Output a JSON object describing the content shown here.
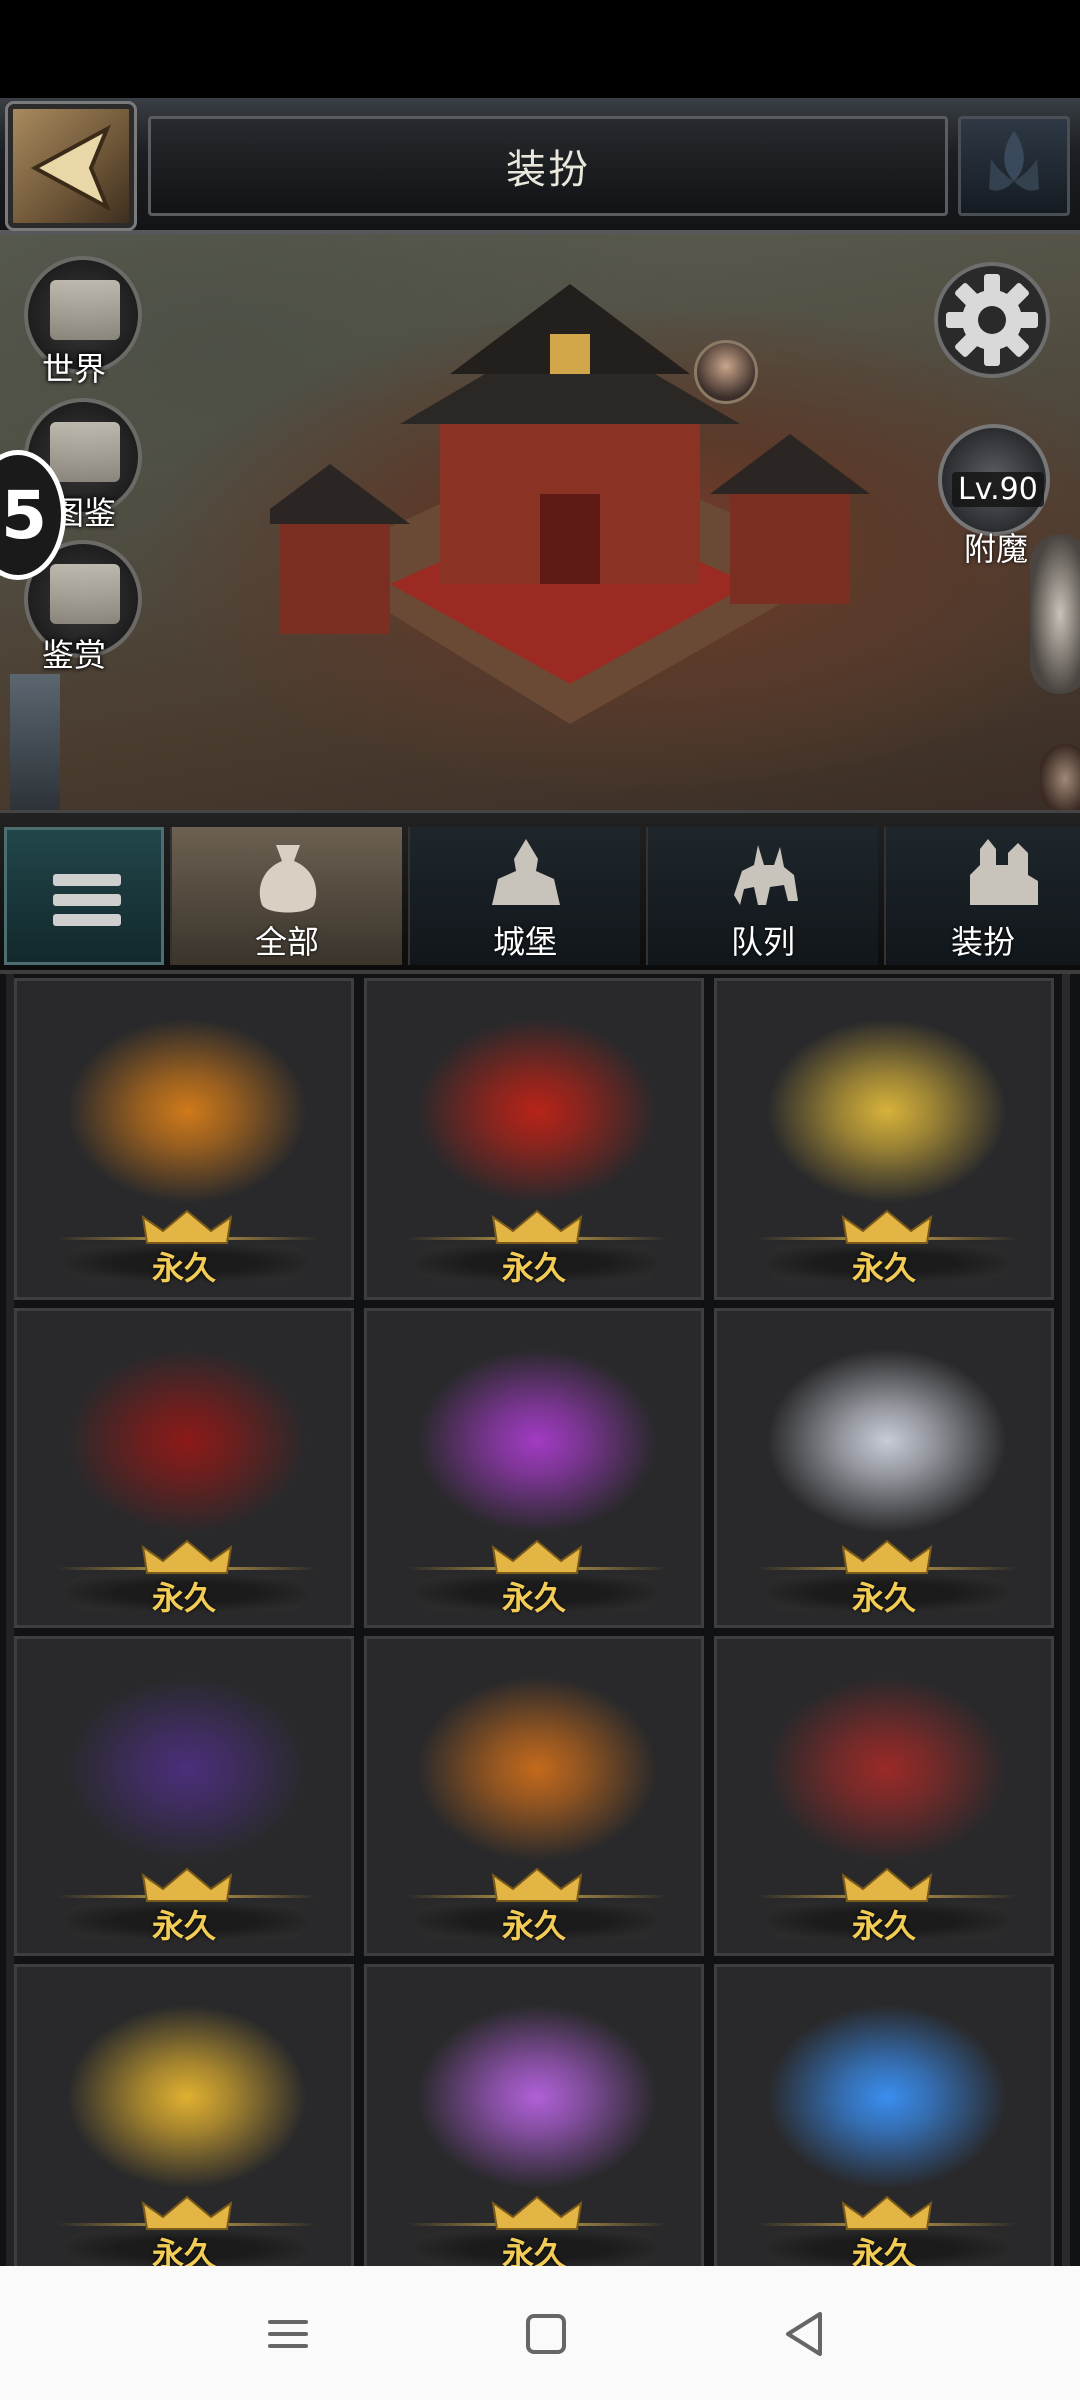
{
  "header": {
    "title": "装扮"
  },
  "scene": {
    "side_buttons": [
      {
        "label": "世界",
        "icon": "world-map-icon"
      },
      {
        "label": "图鉴",
        "icon": "codex-book-icon"
      },
      {
        "label": "鉴赏",
        "icon": "appreciate-icon"
      }
    ],
    "level": "Lv.90",
    "enchant_label": "附魔",
    "badge_number": "5"
  },
  "tabs": [
    {
      "label": "全部",
      "icon": "bag-icon",
      "active": true
    },
    {
      "label": "城堡",
      "icon": "castle-icon",
      "active": false
    },
    {
      "label": "队列",
      "icon": "cavalry-icon",
      "active": false
    },
    {
      "label": "装扮",
      "icon": "fortress-icon",
      "active": false
    }
  ],
  "items": [
    {
      "label": "永久",
      "art": "flaming-dragon-throne",
      "color": "#d07a1a"
    },
    {
      "label": "永久",
      "art": "crimson-demon-warrior",
      "color": "#b82318"
    },
    {
      "label": "永久",
      "art": "golden-lion-dance",
      "color": "#d7b23a"
    },
    {
      "label": "永久",
      "art": "golden-winged-frame",
      "color": "#8c1a18"
    },
    {
      "label": "永久",
      "art": "jester-dancer",
      "color": "#a23bc4"
    },
    {
      "label": "永久",
      "art": "white-pegasus-pair",
      "color": "#c8ccd6"
    },
    {
      "label": "永久",
      "art": "shadow-wings",
      "color": "#4a2f7a"
    },
    {
      "label": "永久",
      "art": "dark-tower-beam",
      "color": "#c46a1c"
    },
    {
      "label": "永久",
      "art": "red-demon-lord",
      "color": "#9a2a28"
    },
    {
      "label": "永久",
      "art": "golden-winged-knight",
      "color": "#e0b030"
    },
    {
      "label": "永久",
      "art": "violet-tiger",
      "color": "#b060d8"
    },
    {
      "label": "永久",
      "art": "azure-dragon",
      "color": "#3a8ef0"
    }
  ]
}
